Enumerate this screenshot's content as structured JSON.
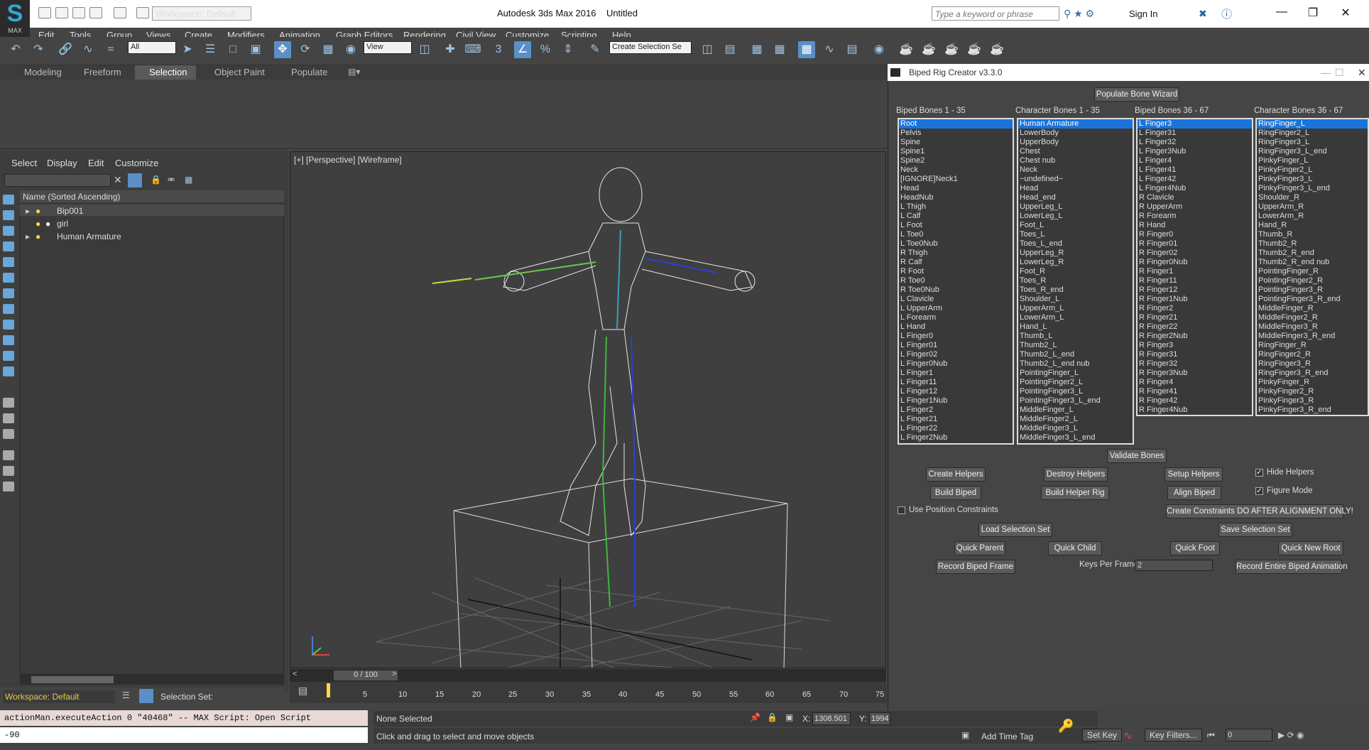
{
  "titlebar": {
    "workspace": "Workspace: Default",
    "title": "Autodesk 3ds Max 2016",
    "untitled": "Untitled",
    "search_placeholder": "Type a keyword or phrase",
    "sign_in": "Sign In",
    "logo": "MAX"
  },
  "menubar": [
    "Edit",
    "Tools",
    "Group",
    "Views",
    "Create",
    "Modifiers",
    "Animation",
    "Graph Editors",
    "Rendering",
    "Civil View",
    "Customize",
    "Scripting",
    "Help"
  ],
  "toolbar": {
    "filter": "All",
    "view": "View",
    "selection_set": "Create Selection Se"
  },
  "ribbon": {
    "tabs": [
      "Modeling",
      "Freeform",
      "Selection",
      "Object Paint",
      "Populate"
    ],
    "active": "Selection"
  },
  "scene_explorer": {
    "menu": [
      "Select",
      "Display",
      "Edit",
      "Customize"
    ],
    "column": "Name (Sorted Ascending)",
    "items": [
      "Bip001",
      "girl",
      "Human Armature"
    ]
  },
  "viewport": {
    "label": "[+] [Perspective] [Wireframe]"
  },
  "timeline": {
    "frame": "0 / 100",
    "ticks": [
      "5",
      "10",
      "15",
      "20",
      "25",
      "30",
      "35",
      "40",
      "45",
      "50",
      "55",
      "60",
      "65",
      "70",
      "75"
    ]
  },
  "bottom": {
    "workspace": "Workspace: Default",
    "selection_set": "Selection Set:",
    "script_line": "actionMan.executeAction 0 \"40468\"  -- MAX Script: Open Script",
    "script_input": "-90",
    "status": "None Selected",
    "prompt": "Click and drag to select and move objects",
    "x_label": "X:",
    "x_value": "1308.501",
    "y_label": "Y:",
    "y_value": "1994",
    "add_time_tag": "Add Time Tag",
    "set_key": "Set Key",
    "key_filters": "Key Filters...",
    "frame": "0"
  },
  "dialog": {
    "title": "Biped Rig Creator v3.3.0",
    "populate": "Populate Bone Wizard",
    "heads": [
      "Biped Bones 1 - 35",
      "Character Bones 1 - 35",
      "Biped Bones 36 - 67",
      "Character Bones 36 - 67"
    ],
    "list1": [
      "Root",
      "Pelvis",
      "Spine",
      "Spine1",
      "Spine2",
      "Neck",
      "[IGNORE]Neck1",
      "Head",
      "HeadNub",
      "L Thigh",
      "L Calf",
      "L Foot",
      "L Toe0",
      "L Toe0Nub",
      "R Thigh",
      "R Calf",
      "R Foot",
      "R Toe0",
      "R Toe0Nub",
      "L Clavicle",
      "L UpperArm",
      "L Forearm",
      "L Hand",
      "L Finger0",
      "L Finger01",
      "L Finger02",
      "L Finger0Nub",
      "L Finger1",
      "L Finger11",
      "L Finger12",
      "L Finger1Nub",
      "L Finger2",
      "L Finger21",
      "L Finger22",
      "L Finger2Nub"
    ],
    "list2": [
      "Human Armature",
      "LowerBody",
      "UpperBody",
      "Chest",
      "Chest nub",
      "Neck",
      "~undefined~",
      "Head",
      "Head_end",
      "UpperLeg_L",
      "LowerLeg_L",
      "Foot_L",
      "Toes_L",
      "Toes_L_end",
      "UpperLeg_R",
      "LowerLeg_R",
      "Foot_R",
      "Toes_R",
      "Toes_R_end",
      "Shoulder_L",
      "UpperArm_L",
      "LowerArm_L",
      "Hand_L",
      "Thumb_L",
      "Thumb2_L",
      "Thumb2_L_end",
      "Thumb2_L_end nub",
      "PointingFinger_L",
      "PointingFinger2_L",
      "PointingFinger3_L",
      "PointingFinger3_L_end",
      "MiddleFinger_L",
      "MiddleFinger2_L",
      "MiddleFinger3_L",
      "MiddleFinger3_L_end"
    ],
    "list3": [
      "L Finger3",
      "L Finger31",
      "L Finger32",
      "L Finger3Nub",
      "L Finger4",
      "L Finger41",
      "L Finger42",
      "L Finger4Nub",
      "R  Clavicle",
      "R  UpperArm",
      "R  Forearm",
      "R  Hand",
      "R  Finger0",
      "R  Finger01",
      "R  Finger02",
      "R  Finger0Nub",
      "R  Finger1",
      "R  Finger11",
      "R  Finger12",
      "R  Finger1Nub",
      "R  Finger2",
      "R  Finger21",
      "R  Finger22",
      "R  Finger2Nub",
      "R  Finger3",
      "R  Finger31",
      "R  Finger32",
      "R  Finger3Nub",
      "R  Finger4",
      "R  Finger41",
      "R  Finger42",
      "R  Finger4Nub"
    ],
    "list4": [
      "RingFinger_L",
      "RingFinger2_L",
      "RingFinger3_L",
      "RingFinger3_L_end",
      "PinkyFinger_L",
      "PinkyFinger2_L",
      "PinkyFinger3_L",
      "PinkyFinger3_L_end",
      "Shoulder_R",
      "UpperArm_R",
      "LowerArm_R",
      "Hand_R",
      "Thumb_R",
      "Thumb2_R",
      "Thumb2_R_end",
      "Thumb2_R_end nub",
      "PointingFinger_R",
      "PointingFinger2_R",
      "PointingFinger3_R",
      "PointingFinger3_R_end",
      "MiddleFinger_R",
      "MiddleFinger2_R",
      "MiddleFinger3_R",
      "MiddleFinger3_R_end",
      "RingFinger_R",
      "RingFinger2_R",
      "RingFinger3_R",
      "RingFinger3_R_end",
      "PinkyFinger_R",
      "PinkyFinger2_R",
      "PinkyFinger3_R",
      "PinkyFinger3_R_end"
    ],
    "buttons": {
      "validate": "Validate Bones",
      "create_helpers": "Create Helpers",
      "destroy_helpers": "Destroy Helpers",
      "setup_helpers": "Setup Helpers",
      "build_biped": "Build Biped",
      "build_helper_rig": "Build Helper Rig",
      "align_biped": "Align Biped",
      "create_constraints": "Create Constraints DO AFTER ALIGNMENT ONLY!",
      "load_sel": "Load Selection Set",
      "save_sel": "Save Selection Set",
      "quick_parent": "Quick Parent",
      "quick_child": "Quick Child",
      "quick_foot": "Quick Foot",
      "quick_root": "Quick New Root",
      "record_frame": "Record Biped Frame",
      "record_all": "Record Entire Biped Animation"
    },
    "hide_helpers": "Hide Helpers",
    "figure_mode": "Figure Mode",
    "use_pos": "Use Position Constraints",
    "keys_per_frame": "Keys Per Frame",
    "keys_value": "2"
  }
}
